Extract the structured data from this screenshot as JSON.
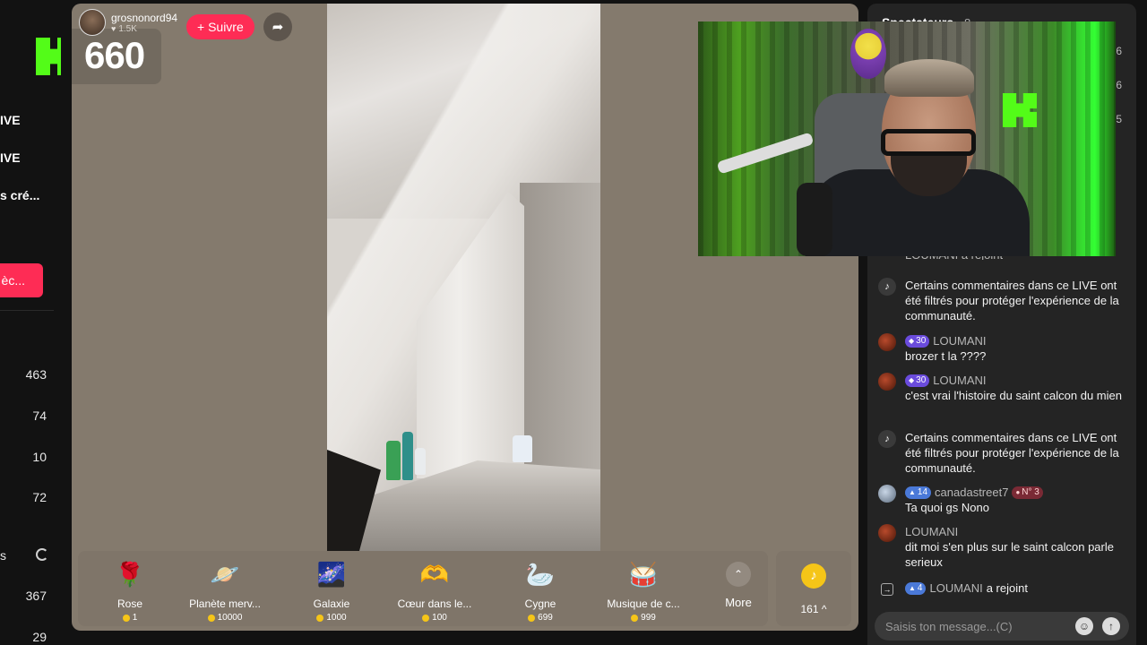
{
  "sidebar": {
    "items": [
      {
        "label": "IVE"
      },
      {
        "label": "IVE"
      },
      {
        "label": "s cré..."
      }
    ],
    "button_label": "èc...",
    "counts": [
      "463",
      "74",
      "10",
      "72"
    ],
    "section_label": "s",
    "counts2": [
      "367",
      "29"
    ]
  },
  "stream": {
    "host_name": "grosnonord94",
    "host_likes": "1.5K",
    "follow_label": "+ Suivre",
    "viewer_count": "660"
  },
  "gifts": [
    {
      "name": "Rose",
      "price": "1",
      "icon": "rose-icon",
      "glyph": "🌹"
    },
    {
      "name": "Planète merv...",
      "price": "10000",
      "icon": "planet-icon",
      "glyph": "🪐"
    },
    {
      "name": "Galaxie",
      "price": "1000",
      "icon": "galaxy-icon",
      "glyph": "🌌"
    },
    {
      "name": "Cœur dans le...",
      "price": "100",
      "icon": "heart-hands-icon",
      "glyph": "🫶"
    },
    {
      "name": "Cygne",
      "price": "699",
      "icon": "swan-icon",
      "glyph": "🦢"
    },
    {
      "name": "Musique de c...",
      "price": "999",
      "icon": "drum-icon",
      "glyph": "🥁"
    }
  ],
  "more_label": "More",
  "coins_label": "161 ^",
  "chat": {
    "title": "Spectateurs",
    "count": "8",
    "ranks": [
      "6",
      "6",
      "5"
    ],
    "partial_line": "LOUMANI a rejoint",
    "messages": [
      {
        "type": "system",
        "text": "Certains commentaires dans ce LIVE ont été filtrés pour protéger l'expérience de la communauté."
      },
      {
        "type": "user",
        "badge": "30",
        "user": "LOUMANI",
        "text": "brozer t la ????"
      },
      {
        "type": "user",
        "badge": "30",
        "user": "LOUMANI",
        "text": "c'est vrai l'histoire du saint calcon du mien"
      },
      {
        "type": "system",
        "text": "Certains commentaires dans ce LIVE ont été filtrés pour protéger l'expérience de la communauté."
      },
      {
        "type": "user",
        "badge": "14",
        "user": "canadastreet7",
        "rank_badge": "N° 3",
        "text": "Ta quoi gs Nono"
      },
      {
        "type": "user",
        "user": "LOUMANI",
        "text": "dit moi s'en plus sur le saint calcon parle serieux"
      },
      {
        "type": "join",
        "badge": "4",
        "user": "LOUMANI",
        "text": "a rejoint"
      }
    ],
    "input_placeholder": "Saisis ton message...(C)"
  },
  "colors": {
    "accent_red": "#fe2c55",
    "kick_green": "#53fc18",
    "panel_bg": "#847a6d",
    "chat_bg": "#242424"
  }
}
